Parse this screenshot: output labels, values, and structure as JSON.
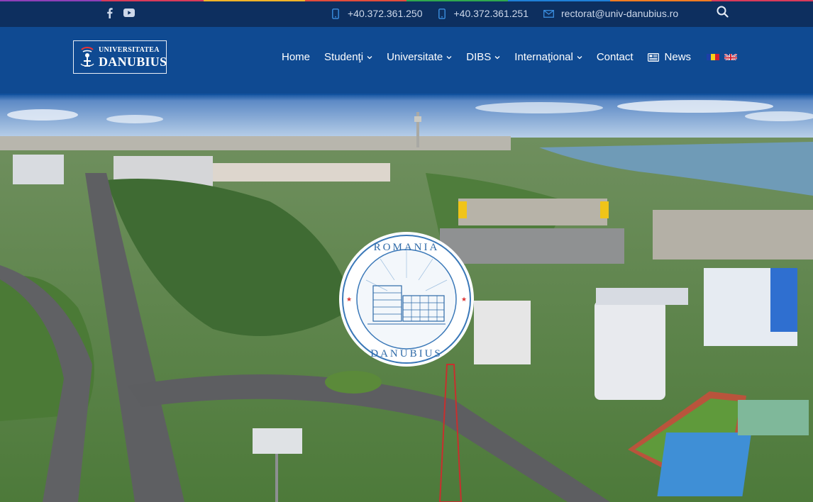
{
  "topbar": {
    "stripe_colors": [
      "#8e3fb7",
      "#d83a5a",
      "#f0b429",
      "#e14c3c",
      "#2fa84f",
      "#1f80d8",
      "#f07c22",
      "#d83a5a"
    ],
    "social": [
      {
        "icon": "facebook-icon"
      },
      {
        "icon": "youtube-icon"
      }
    ],
    "contacts": [
      {
        "icon": "phone-icon",
        "text": "+40.372.361.250"
      },
      {
        "icon": "phone-icon",
        "text": "+40.372.361.251"
      },
      {
        "icon": "envelope-icon",
        "text": "rectorat@univ-danubius.ro"
      }
    ],
    "search_icon": "search-icon"
  },
  "header": {
    "logo": {
      "line1": "UNIVERSITATEA",
      "line2": "DANUBIUS"
    },
    "nav": [
      {
        "label": "Home",
        "dropdown": false
      },
      {
        "label": "Studenţi",
        "dropdown": true
      },
      {
        "label": "Universitate",
        "dropdown": true
      },
      {
        "label": "DIBS",
        "dropdown": true
      },
      {
        "label": "Internaţional",
        "dropdown": true
      },
      {
        "label": "Contact",
        "dropdown": false
      },
      {
        "label": "News",
        "dropdown": false,
        "icon": "newspaper-icon"
      }
    ],
    "languages": [
      {
        "code": "ro",
        "icon": "romania-flag-icon"
      },
      {
        "code": "en",
        "icon": "uk-flag-icon"
      }
    ]
  },
  "hero": {
    "seal": {
      "top": "ROMANIA",
      "bottom": "DANUBIUS"
    }
  },
  "colors": {
    "topbar_bg": "#0d2f5f",
    "header_bg": "#0f4a92",
    "accent": "#ffffff"
  }
}
